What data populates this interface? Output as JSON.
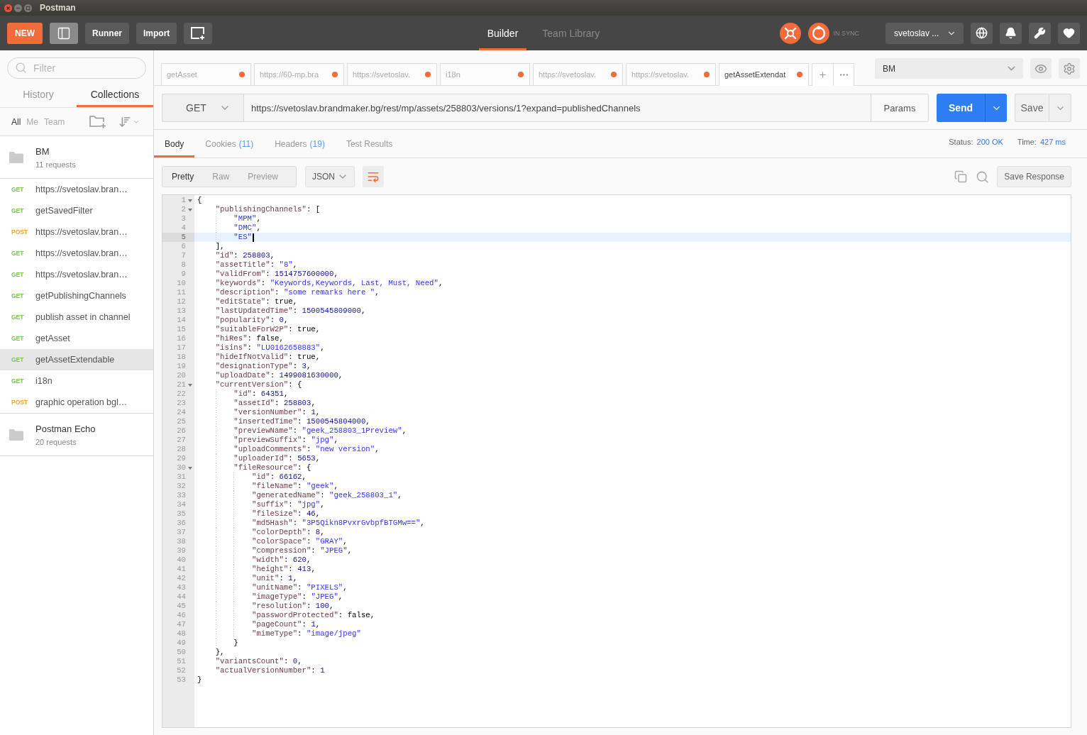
{
  "window": {
    "title": "Postman"
  },
  "toolbar": {
    "new_button": "NEW",
    "sidebar_toggle": {
      "on": true
    },
    "buttons": [
      "Runner",
      "Import"
    ],
    "nav_tabs": [
      {
        "label": "Builder",
        "selected": true
      },
      {
        "label": "Team Library",
        "selected": false
      }
    ],
    "sync_status": "IN SYNC",
    "user_menu": "svetoslav ..."
  },
  "sidebar": {
    "filter": {
      "placeholder": "Filter"
    },
    "tabs": [
      {
        "label": "History",
        "selected": false
      },
      {
        "label": "Collections",
        "selected": true
      }
    ],
    "owner_filters": [
      {
        "label": "All",
        "selected": true
      },
      {
        "label": "Me",
        "selected": false
      },
      {
        "label": "Team",
        "selected": false
      }
    ],
    "collections": [
      {
        "name": "BM",
        "count": "11 requests",
        "requests": [
          {
            "method": "GET",
            "color": "#7cc73a",
            "name": "https://svetoslav.bran…",
            "selected": false
          },
          {
            "method": "GET",
            "color": "#7cc73a",
            "name": "getSavedFilter",
            "selected": false
          },
          {
            "method": "POST",
            "color": "#f5a623",
            "name": "https://svetoslav.bran…",
            "selected": false
          },
          {
            "method": "GET",
            "color": "#7cc73a",
            "name": "https://svetoslav.bran…",
            "selected": false
          },
          {
            "method": "GET",
            "color": "#7cc73a",
            "name": "https://svetoslav.bran…",
            "selected": false
          },
          {
            "method": "GET",
            "color": "#7cc73a",
            "name": "getPublishingChannels",
            "selected": false
          },
          {
            "method": "GET",
            "color": "#7cc73a",
            "name": "publish asset in channel",
            "selected": false
          },
          {
            "method": "GET",
            "color": "#7cc73a",
            "name": "getAsset",
            "selected": false
          },
          {
            "method": "GET",
            "color": "#7cc73a",
            "name": "getAssetExtendable",
            "selected": true
          },
          {
            "method": "GET",
            "color": "#7cc73a",
            "name": "i18n",
            "selected": false
          },
          {
            "method": "POST",
            "color": "#f5a623",
            "name": "graphic operation bgl…",
            "selected": false
          }
        ]
      },
      {
        "name": "Postman Echo",
        "count": "20 requests"
      }
    ]
  },
  "request_tabs": [
    {
      "label": "getAsset",
      "unsaved": true,
      "selected": false
    },
    {
      "label": "https://60-mp.bra",
      "unsaved": true,
      "selected": false
    },
    {
      "label": "https://svetoslav.",
      "unsaved": true,
      "selected": false
    },
    {
      "label": "i18n",
      "unsaved": true,
      "selected": false
    },
    {
      "label": "https://svetoslav.",
      "unsaved": true,
      "selected": false
    },
    {
      "label": "https://svetoslav.",
      "unsaved": true,
      "selected": false
    },
    {
      "label": "getAssetExtendat",
      "unsaved": true,
      "selected": true
    }
  ],
  "environment": {
    "value": "BM"
  },
  "request": {
    "method": "GET",
    "url": "https://svetoslav.brandmaker.bg/rest/mp/assets/258803/versions/1?expand=publishedChannels",
    "params_button": "Params",
    "send_button": "Send",
    "save_button": "Save"
  },
  "response": {
    "tabs": [
      {
        "label": "Body",
        "selected": true
      },
      {
        "label": "Cookies",
        "count": "(11)",
        "selected": false
      },
      {
        "label": "Headers",
        "count": "(19)",
        "selected": false
      },
      {
        "label": "Test Results",
        "selected": false
      }
    ],
    "status_label": "Status:",
    "status": "200 OK",
    "time_label": "Time:",
    "time": "427 ms",
    "view_modes": [
      {
        "label": "Pretty",
        "selected": true
      },
      {
        "label": "Raw",
        "selected": false
      },
      {
        "label": "Preview",
        "selected": false
      }
    ],
    "format": "JSON",
    "wrap": {
      "on": true
    },
    "save_response_button": "Save Response",
    "lines": [
      {
        "number": "1",
        "text": "{",
        "foldable": true,
        "current": false
      },
      {
        "number": "2",
        "text": "    \"publishingChannels\": [",
        "foldable": true,
        "current": false
      },
      {
        "number": "3",
        "text": "        \"MPM\",",
        "foldable": false,
        "current": false
      },
      {
        "number": "4",
        "text": "        \"DMC\",",
        "foldable": false,
        "current": false
      },
      {
        "number": "5",
        "text": "        \"ES\"",
        "foldable": false,
        "current": true
      },
      {
        "number": "6",
        "text": "    ],",
        "foldable": false,
        "current": false
      },
      {
        "number": "7",
        "text": "    \"id\": 258803,",
        "foldable": false,
        "current": false
      },
      {
        "number": "8",
        "text": "    \"assetTitle\": \"8\",",
        "foldable": false,
        "current": false
      },
      {
        "number": "9",
        "text": "    \"validFrom\": 1514757600000,",
        "foldable": false,
        "current": false
      },
      {
        "number": "10",
        "text": "    \"keywords\": \"Keywords,Keywords, Last, Must, Need\",",
        "foldable": false,
        "current": false
      },
      {
        "number": "11",
        "text": "    \"description\": \"some remarks here \",",
        "foldable": false,
        "current": false
      },
      {
        "number": "12",
        "text": "    \"editState\": true,",
        "foldable": false,
        "current": false
      },
      {
        "number": "13",
        "text": "    \"lastUpdatedTime\": 1500545809000,",
        "foldable": false,
        "current": false
      },
      {
        "number": "14",
        "text": "    \"popularity\": 0,",
        "foldable": false,
        "current": false
      },
      {
        "number": "15",
        "text": "    \"suitableForW2P\": true,",
        "foldable": false,
        "current": false
      },
      {
        "number": "16",
        "text": "    \"hiRes\": false,",
        "foldable": false,
        "current": false
      },
      {
        "number": "17",
        "text": "    \"isins\": \"LU0162658883\",",
        "foldable": false,
        "current": false
      },
      {
        "number": "18",
        "text": "    \"hideIfNotValid\": true,",
        "foldable": false,
        "current": false
      },
      {
        "number": "19",
        "text": "    \"designationType\": 3,",
        "foldable": false,
        "current": false
      },
      {
        "number": "20",
        "text": "    \"uploadDate\": 1499081630000,",
        "foldable": false,
        "current": false
      },
      {
        "number": "21",
        "text": "    \"currentVersion\": {",
        "foldable": true,
        "current": false
      },
      {
        "number": "22",
        "text": "        \"id\": 64351,",
        "foldable": false,
        "current": false
      },
      {
        "number": "23",
        "text": "        \"assetId\": 258803,",
        "foldable": false,
        "current": false
      },
      {
        "number": "24",
        "text": "        \"versionNumber\": 1,",
        "foldable": false,
        "current": false
      },
      {
        "number": "25",
        "text": "        \"insertedTime\": 1500545804000,",
        "foldable": false,
        "current": false
      },
      {
        "number": "26",
        "text": "        \"previewName\": \"geek_258803_1Preview\",",
        "foldable": false,
        "current": false
      },
      {
        "number": "27",
        "text": "        \"previewSuffix\": \"jpg\",",
        "foldable": false,
        "current": false
      },
      {
        "number": "28",
        "text": "        \"uploadComments\": \"new version\",",
        "foldable": false,
        "current": false
      },
      {
        "number": "29",
        "text": "        \"uploaderId\": 5653,",
        "foldable": false,
        "current": false
      },
      {
        "number": "30",
        "text": "        \"fileResource\": {",
        "foldable": true,
        "current": false
      },
      {
        "number": "31",
        "text": "            \"id\": 66162,",
        "foldable": false,
        "current": false
      },
      {
        "number": "32",
        "text": "            \"fileName\": \"geek\",",
        "foldable": false,
        "current": false
      },
      {
        "number": "33",
        "text": "            \"generatedName\": \"geek_258803_1\",",
        "foldable": false,
        "current": false
      },
      {
        "number": "34",
        "text": "            \"suffix\": \"jpg\",",
        "foldable": false,
        "current": false
      },
      {
        "number": "35",
        "text": "            \"fileSize\": 46,",
        "foldable": false,
        "current": false
      },
      {
        "number": "36",
        "text": "            \"md5Hash\": \"3P5Qikn8PvxrGvbpfBTGMw==\",",
        "foldable": false,
        "current": false
      },
      {
        "number": "37",
        "text": "            \"colorDepth\": 8,",
        "foldable": false,
        "current": false
      },
      {
        "number": "38",
        "text": "            \"colorSpace\": \"GRAY\",",
        "foldable": false,
        "current": false
      },
      {
        "number": "39",
        "text": "            \"compression\": \"JPEG\",",
        "foldable": false,
        "current": false
      },
      {
        "number": "40",
        "text": "            \"width\": 620,",
        "foldable": false,
        "current": false
      },
      {
        "number": "41",
        "text": "            \"height\": 413,",
        "foldable": false,
        "current": false
      },
      {
        "number": "42",
        "text": "            \"unit\": 1,",
        "foldable": false,
        "current": false
      },
      {
        "number": "43",
        "text": "            \"unitName\": \"PIXELS\",",
        "foldable": false,
        "current": false
      },
      {
        "number": "44",
        "text": "            \"imageType\": \"JPEG\",",
        "foldable": false,
        "current": false
      },
      {
        "number": "45",
        "text": "            \"resolution\": 100,",
        "foldable": false,
        "current": false
      },
      {
        "number": "46",
        "text": "            \"passwordProtected\": false,",
        "foldable": false,
        "current": false
      },
      {
        "number": "47",
        "text": "            \"pageCount\": 1,",
        "foldable": false,
        "current": false
      },
      {
        "number": "48",
        "text": "            \"mimeType\": \"image/jpeg\"",
        "foldable": false,
        "current": false
      },
      {
        "number": "49",
        "text": "        }",
        "foldable": false,
        "current": false
      },
      {
        "number": "50",
        "text": "    },",
        "foldable": false,
        "current": false
      },
      {
        "number": "51",
        "text": "    \"variantsCount\": 0,",
        "foldable": false,
        "current": false
      },
      {
        "number": "52",
        "text": "    \"actualVersionNumber\": 1",
        "foldable": false,
        "current": false
      },
      {
        "number": "53",
        "text": "}",
        "foldable": false,
        "current": false
      }
    ]
  }
}
